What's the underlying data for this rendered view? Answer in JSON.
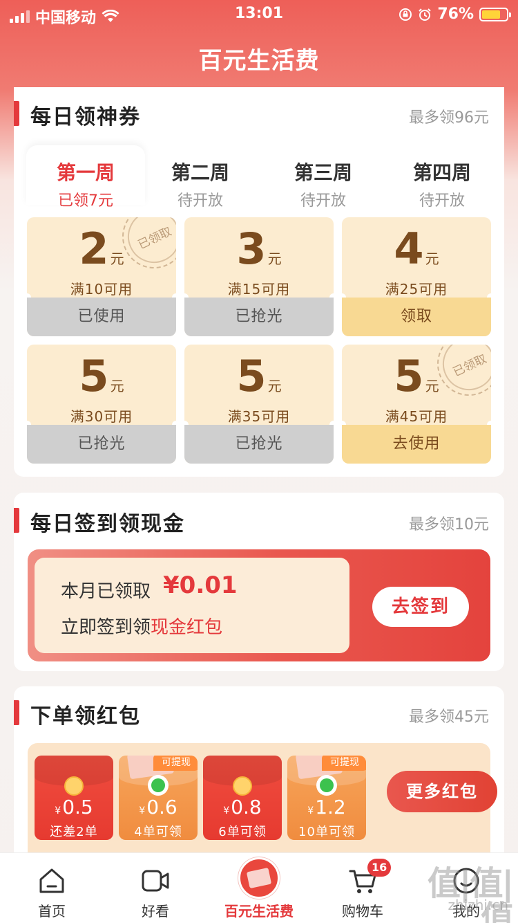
{
  "status_bar": {
    "carrier": "中国移动",
    "time": "13:01",
    "battery": "76%",
    "battery_level": 0.76,
    "icons": [
      "signal-icon",
      "wifi-icon",
      "rotation-lock-icon",
      "alarm-icon",
      "battery-icon"
    ]
  },
  "header": {
    "title": "百元生活费"
  },
  "coupons": {
    "title": "每日领神券",
    "note": "最多领96元",
    "tabs": [
      {
        "name": "第一周",
        "sub": "已领7元",
        "active": true
      },
      {
        "name": "第二周",
        "sub": "待开放",
        "active": false
      },
      {
        "name": "第三周",
        "sub": "待开放",
        "active": false
      },
      {
        "name": "第四周",
        "sub": "待开放",
        "active": false
      }
    ],
    "unit": "元",
    "items": [
      {
        "amount": "2",
        "condition": "满10可用",
        "action": "已使用",
        "style": "gray",
        "stamp": "已领取"
      },
      {
        "amount": "3",
        "condition": "满15可用",
        "action": "已抢光",
        "style": "gray",
        "stamp": ""
      },
      {
        "amount": "4",
        "condition": "满25可用",
        "action": "领取",
        "style": "gold",
        "stamp": ""
      },
      {
        "amount": "5",
        "condition": "满30可用",
        "action": "已抢光",
        "style": "gray",
        "stamp": ""
      },
      {
        "amount": "5",
        "condition": "满35可用",
        "action": "已抢光",
        "style": "gray",
        "stamp": ""
      },
      {
        "amount": "5",
        "condition": "满45可用",
        "action": "去使用",
        "style": "gold",
        "stamp": "已领取"
      }
    ]
  },
  "checkin": {
    "title": "每日签到领现金",
    "note": "最多领10元",
    "line1_label": "本月已领取",
    "amount": "¥0.01",
    "line2_prefix": "立即签到领",
    "line2_highlight": "现金红包",
    "button": "去签到"
  },
  "redpack": {
    "title": "下单领红包",
    "note": "最多领45元",
    "currency": "¥",
    "items": [
      {
        "amount": "0.5",
        "label": "还差2单",
        "style": "red",
        "tag": "",
        "icon": "coin-icon"
      },
      {
        "amount": "0.6",
        "label": "4单可领",
        "style": "orange",
        "tag": "可提现",
        "icon": "wechat-icon"
      },
      {
        "amount": "0.8",
        "label": "6单可领",
        "style": "red",
        "tag": "",
        "icon": "coin-icon"
      },
      {
        "amount": "1.2",
        "label": "10单可领",
        "style": "orange",
        "tag": "可提现",
        "icon": "wechat-icon"
      }
    ],
    "more_button": "更多红包"
  },
  "tab_bar": {
    "tabs": [
      {
        "label": "首页",
        "icon": "home-icon",
        "active": false
      },
      {
        "label": "好看",
        "icon": "video-icon",
        "active": false
      },
      {
        "label": "百元生活费",
        "icon": "redpack-icon",
        "active": true
      },
      {
        "label": "购物车",
        "icon": "cart-icon",
        "active": false,
        "badge": "16"
      },
      {
        "label": "我的",
        "icon": "profile-icon",
        "active": false
      }
    ]
  },
  "watermark": {
    "text": "值|值|值",
    "sub": "zhizhi.cn"
  },
  "colors": {
    "brand_red": "#e4393c",
    "coupon_bg": "#fcecd0",
    "coupon_gold": "#f8d993",
    "coupon_gray": "#cfcfcf"
  }
}
